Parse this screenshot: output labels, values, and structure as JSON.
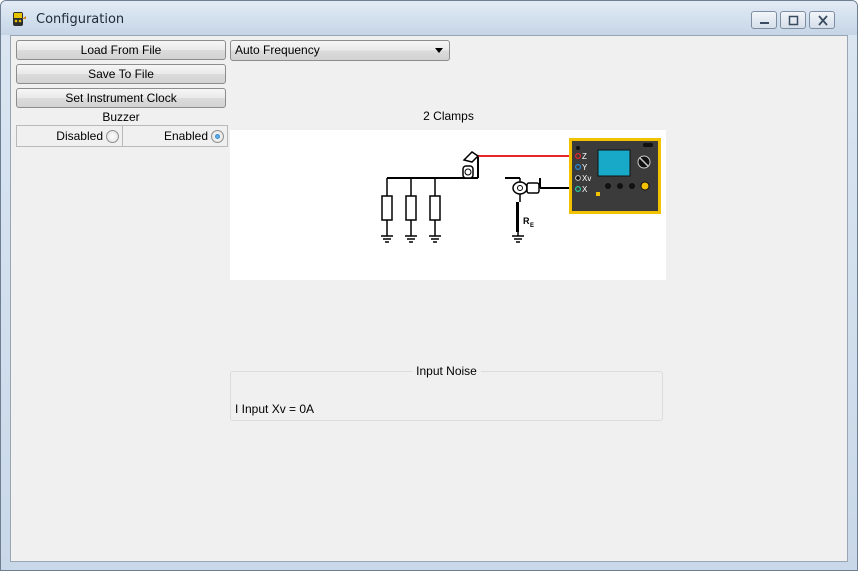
{
  "window": {
    "title": "Configuration",
    "icon": "instrument-app-icon"
  },
  "controls": {
    "load_label": "Load From File",
    "save_label": "Save To File",
    "clock_label": "Set Instrument Clock"
  },
  "buzzer": {
    "title": "Buzzer",
    "options": [
      {
        "label": "Disabled",
        "checked": false
      },
      {
        "label": "Enabled",
        "checked": true
      }
    ]
  },
  "frequency": {
    "selected": "Auto Frequency"
  },
  "diagram": {
    "title": "2 Clamps",
    "terminals": [
      "Z",
      "Y",
      "Xv",
      "X"
    ],
    "resistor_label": "R",
    "resistor_subscript": "E",
    "colors": {
      "lead_red": "#e8262c",
      "device_body": "#3b3b3b",
      "device_border": "#f2c200",
      "screen": "#18a9c9"
    }
  },
  "noise": {
    "title": "Input Noise",
    "value": "I Input Xv = 0A"
  }
}
